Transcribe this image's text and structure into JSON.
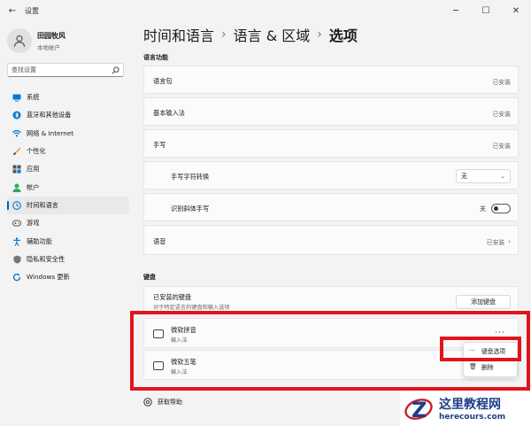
{
  "window": {
    "title": "设置",
    "controls": {
      "minimize": "─",
      "maximize": "☐",
      "close": "✕"
    }
  },
  "user": {
    "name": "田园牧风",
    "account": "本地帐户"
  },
  "search": {
    "placeholder": "查找设置"
  },
  "sidebar": {
    "items": [
      {
        "label": "系统",
        "icon": "monitor-icon",
        "color": "#0078d4"
      },
      {
        "label": "蓝牙和其他设备",
        "icon": "bluetooth-icon",
        "color": "#0078d4"
      },
      {
        "label": "网络 & Internet",
        "icon": "wifi-icon",
        "color": "#0078d4"
      },
      {
        "label": "个性化",
        "icon": "brush-icon",
        "color": "#e48a2b"
      },
      {
        "label": "应用",
        "icon": "apps-icon",
        "color": "#555555"
      },
      {
        "label": "帐户",
        "icon": "person-icon",
        "color": "#2eaa5f"
      },
      {
        "label": "时间和语言",
        "icon": "globe-clock-icon",
        "color": "#0078d4",
        "active": true
      },
      {
        "label": "游戏",
        "icon": "gamepad-icon",
        "color": "#555555"
      },
      {
        "label": "辅助功能",
        "icon": "accessibility-icon",
        "color": "#0078d4"
      },
      {
        "label": "隐私和安全性",
        "icon": "shield-icon",
        "color": "#555555"
      },
      {
        "label": "Windows 更新",
        "icon": "update-icon",
        "color": "#0078d4"
      }
    ]
  },
  "breadcrumb": {
    "part1": "时间和语言",
    "part2": "语言 & 区域",
    "current": "选项",
    "sep": "›"
  },
  "language_section": {
    "heading": "语言功能",
    "rows": {
      "language_pack": {
        "label": "语言包",
        "status": "已安装"
      },
      "basic_input": {
        "label": "基本输入法",
        "status": "已安装"
      },
      "handwriting": {
        "label": "手写",
        "status": "已安装"
      },
      "handwriting_convert": {
        "label": "手写字符转换",
        "value": "无"
      },
      "handwriting_font": {
        "label": "识别斜体手写",
        "toggle": "关"
      },
      "speech": {
        "label": "语音",
        "status": "已安装"
      }
    }
  },
  "keyboard_section": {
    "heading": "键盘",
    "installed": {
      "title": "已安装的键盘",
      "subtitle": "对于特定语言的键盘和输入选项",
      "button": "添加键盘"
    },
    "keyboards": [
      {
        "name": "微软拼音",
        "type": "输入法"
      },
      {
        "name": "微软五笔",
        "type": "输入法"
      }
    ],
    "more": "···"
  },
  "context_menu": {
    "items": [
      {
        "label": "键盘选项",
        "icon": "···"
      },
      {
        "label": "删除",
        "icon": "🗑"
      }
    ]
  },
  "help": {
    "label": "获取帮助"
  },
  "watermark": {
    "cn": "这里教程网",
    "url": "herecours.com"
  },
  "colors": {
    "accent": "#005fb8",
    "highlight": "#e0141c",
    "watermark": "#1e3e8a"
  }
}
